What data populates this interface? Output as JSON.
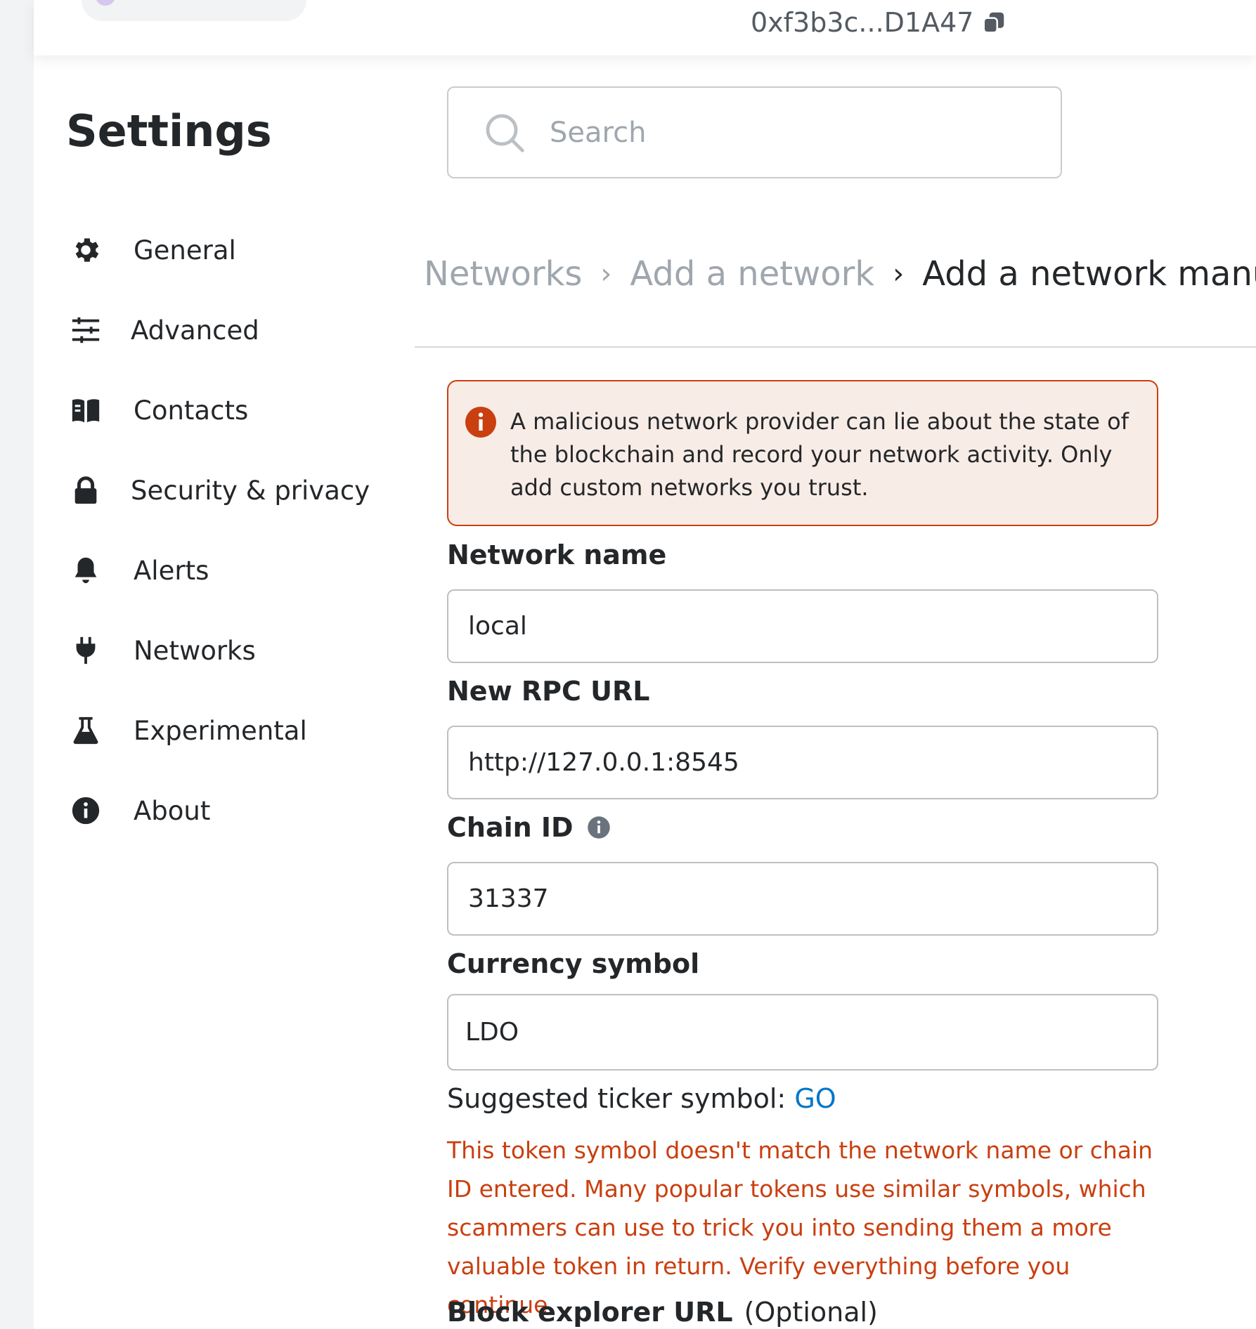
{
  "header": {
    "account_address": "0xf3b3c...D1A47"
  },
  "sidebar": {
    "title": "Settings",
    "items": [
      {
        "label": "General",
        "icon": "gear-icon"
      },
      {
        "label": "Advanced",
        "icon": "sliders-icon"
      },
      {
        "label": "Contacts",
        "icon": "book-icon"
      },
      {
        "label": "Security & privacy",
        "icon": "lock-icon"
      },
      {
        "label": "Alerts",
        "icon": "bell-icon"
      },
      {
        "label": "Networks",
        "icon": "plug-icon"
      },
      {
        "label": "Experimental",
        "icon": "flask-icon"
      },
      {
        "label": "About",
        "icon": "info-icon"
      }
    ]
  },
  "search": {
    "placeholder": "Search"
  },
  "breadcrumb": {
    "level1": "Networks",
    "level2": "Add a network",
    "current": "Add a network manually"
  },
  "warning": {
    "text": "A malicious network provider can lie about the state of the blockchain and record your network activity. Only add custom networks you trust."
  },
  "form": {
    "network_name": {
      "label": "Network name",
      "value": "local"
    },
    "rpc_url": {
      "label": "New RPC URL",
      "value": "http://127.0.0.1:8545"
    },
    "chain_id": {
      "label": "Chain ID",
      "value": "31337"
    },
    "currency_symbol": {
      "label": "Currency symbol",
      "value": "LDO"
    },
    "suggested_ticker_label": "Suggested ticker symbol:",
    "suggested_ticker_value": "GO",
    "symbol_warning": "This token symbol doesn't match the network name or chain ID entered. Many popular tokens use similar symbols, which scammers can use to trick you into sending them a more valuable token in return. Verify everything before you continue.",
    "block_explorer": {
      "label": "Block explorer URL",
      "optional": "(Optional)"
    }
  },
  "colors": {
    "warning_border": "#ca3f0f",
    "warning_bg": "#f8ece6",
    "link": "#0376c9",
    "muted": "#9fa6ae"
  }
}
